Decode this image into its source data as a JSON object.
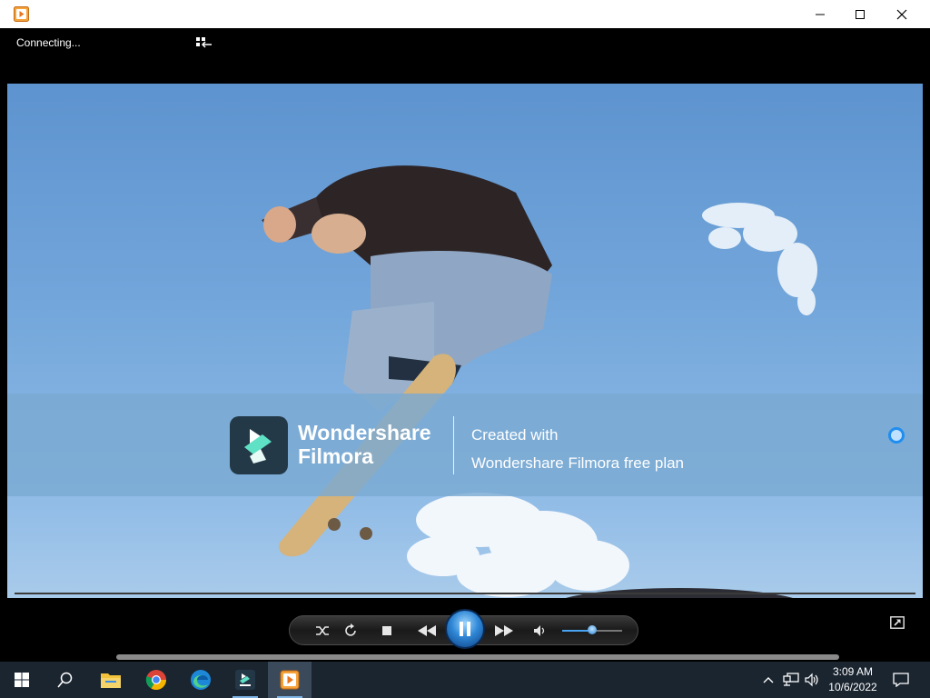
{
  "window": {
    "app_icon": "media-player-app-icon",
    "controls": [
      "minimize-icon",
      "maximize-icon",
      "close-icon"
    ]
  },
  "header": {
    "status": "Connecting...",
    "switch_icon": "switch-to-library-icon"
  },
  "watermark": {
    "brand_line1": "Wondershare",
    "brand_line2": "Filmora",
    "created_line1": "Created with",
    "created_line2": "Wondershare Filmora free plan"
  },
  "player": {
    "controls": [
      "shuffle-icon",
      "repeat-icon",
      "stop-icon",
      "previous-icon",
      "pause-icon",
      "next-icon",
      "volume-icon"
    ],
    "volume_level": 0.5,
    "switch_view_icon": "switch-to-now-playing-icon"
  },
  "taskbar": {
    "items": [
      "windows-start-icon",
      "search-icon",
      "file-explorer-icon",
      "chrome-icon",
      "edge-icon",
      "filmora-icon",
      "media-player-icon"
    ],
    "tray": [
      "chevron-up-icon",
      "network-icon",
      "speaker-icon"
    ],
    "time": "3:09 AM",
    "date": "10/6/2022",
    "notifications_icon": "action-center-icon"
  },
  "colors": {
    "taskbar": "#1b2530",
    "accent": "#2f87d6",
    "sky": "#74a7db"
  }
}
